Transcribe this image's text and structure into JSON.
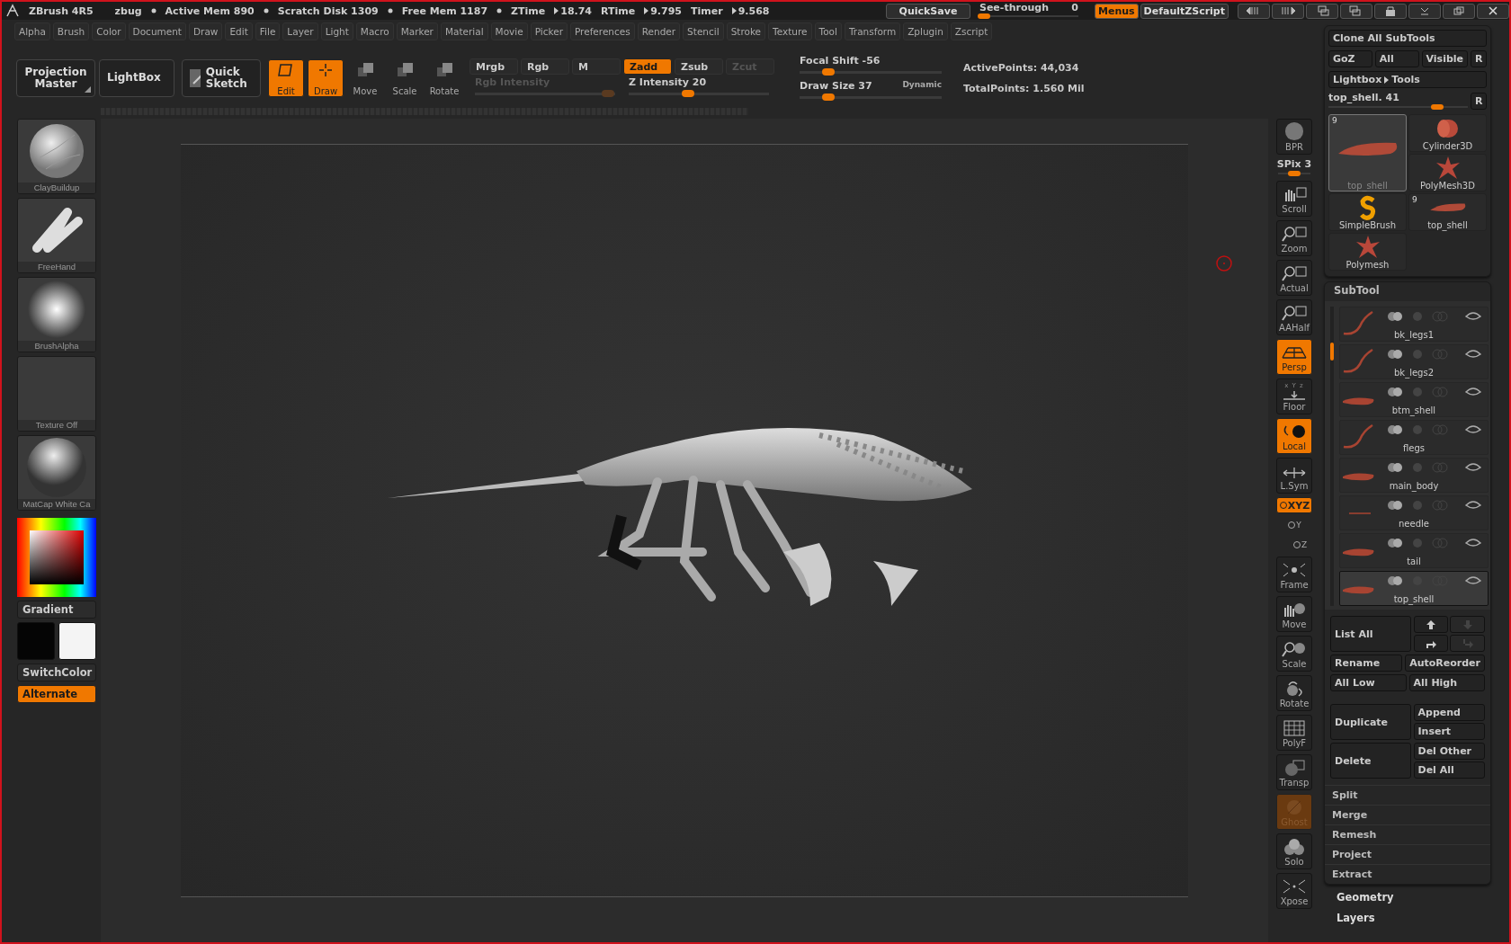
{
  "title_bar": {
    "app": "ZBrush 4R5",
    "document": "zbug",
    "stats": [
      "Active Mem 890",
      "Scratch Disk 1309",
      "Free Mem 1187"
    ],
    "timers": [
      {
        "label": "ZTime",
        "value": "18.74"
      },
      {
        "label": "RTime",
        "value": "9.795"
      },
      {
        "label": "Timer",
        "value": "9.568"
      }
    ],
    "quicksave": "QuickSave",
    "see_through": {
      "label": "See-through",
      "value": "0",
      "level": 0.05
    },
    "menus": {
      "label": "Menus",
      "selected": true
    },
    "script": "DefaultZScript"
  },
  "menu_bar": [
    "Alpha",
    "Brush",
    "Color",
    "Document",
    "Draw",
    "Edit",
    "File",
    "Layer",
    "Light",
    "Macro",
    "Marker",
    "Material",
    "Movie",
    "Picker",
    "Preferences",
    "Render",
    "Stencil",
    "Stroke",
    "Texture",
    "Tool",
    "Transform",
    "Zplugin",
    "Zscript"
  ],
  "shelf": {
    "projection_master": "Projection Master",
    "lightbox": "LightBox",
    "quick_sketch": "Quick Sketch",
    "modes": [
      {
        "kind": "edit",
        "label": "Edit",
        "selected": true
      },
      {
        "kind": "draw",
        "label": "Draw",
        "selected": true
      },
      {
        "kind": "move",
        "label": "Move",
        "selected": false
      },
      {
        "kind": "scale",
        "label": "Scale",
        "selected": false
      },
      {
        "kind": "rotate",
        "label": "Rotate",
        "selected": false
      }
    ],
    "channels": [
      {
        "label": "Mrgb",
        "selected": false,
        "disabled": false
      },
      {
        "label": "Rgb",
        "selected": false,
        "disabled": false
      },
      {
        "label": "M",
        "selected": false,
        "disabled": false
      },
      {
        "label": "Zadd",
        "selected": true,
        "disabled": false
      },
      {
        "label": "Zsub",
        "selected": false,
        "disabled": false
      },
      {
        "label": "Zcut",
        "selected": false,
        "disabled": true
      }
    ],
    "intensity": [
      {
        "label": "Rgb Intensity",
        "level": 0.95,
        "disabled": true
      },
      {
        "label": "Z Intensity 20",
        "level": 0.42,
        "disabled": false
      }
    ],
    "brush_sliders": [
      {
        "label": "Focal Shift -56",
        "level": 0.2
      },
      {
        "label": "Draw Size 37",
        "level": 0.2,
        "tag": "Dynamic"
      }
    ],
    "points": [
      "ActivePoints: 44,034",
      "TotalPoints: 1.560 Mil"
    ]
  },
  "left_panel": {
    "thumbnails": [
      {
        "kind": "sphere",
        "label": "ClayBuildup"
      },
      {
        "kind": "stroke",
        "label": "FreeHand"
      },
      {
        "kind": "alpha",
        "label": "BrushAlpha"
      },
      {
        "kind": "empty",
        "label": "Texture Off"
      },
      {
        "kind": "matcap",
        "label": "MatCap White Ca"
      }
    ],
    "gradient": "Gradient",
    "switch_color": "SwitchColor",
    "alternate": {
      "label": "Alternate",
      "on": true
    }
  },
  "right_shelf": [
    {
      "kind": "bpr",
      "label": "BPR",
      "on": false,
      "disabled": false
    },
    {
      "kind": "slider",
      "label": "SPix 3",
      "level": 0.5
    },
    {
      "kind": "scroll",
      "label": "Scroll",
      "on": false,
      "disabled": false
    },
    {
      "kind": "zoom",
      "label": "Zoom",
      "on": false,
      "disabled": false
    },
    {
      "kind": "actual",
      "label": "Actual",
      "on": false,
      "disabled": false
    },
    {
      "kind": "aahalf",
      "label": "AAHalf",
      "on": false,
      "disabled": false
    },
    {
      "kind": "persp",
      "label": "Persp",
      "on": true,
      "disabled": false
    },
    {
      "kind": "floor",
      "label": "Floor",
      "axes": "x Y z",
      "on": false,
      "disabled": false
    },
    {
      "kind": "local",
      "label": "Local",
      "on": true,
      "disabled": false
    },
    {
      "kind": "lsym",
      "label": "L.Sym",
      "on": false,
      "disabled": false
    },
    {
      "kind": "pill",
      "label": "XYZ",
      "on": true,
      "disabled": false
    },
    {
      "kind": "rot",
      "label": "Y",
      "on": false,
      "disabled": false
    },
    {
      "kind": "rot",
      "label": "Z",
      "on": false,
      "disabled": false
    },
    {
      "kind": "frame",
      "label": "Frame",
      "on": false,
      "disabled": false
    },
    {
      "kind": "move",
      "label": "Move",
      "on": false,
      "disabled": false
    },
    {
      "kind": "scale",
      "label": "Scale",
      "on": false,
      "disabled": false
    },
    {
      "kind": "rotate",
      "label": "Rotate",
      "on": false,
      "disabled": false
    },
    {
      "kind": "polyf",
      "label": "PolyF",
      "on": false,
      "disabled": false
    },
    {
      "kind": "transp",
      "label": "Transp",
      "on": false,
      "disabled": false
    },
    {
      "kind": "ghost",
      "label": "Ghost",
      "on": true,
      "disabled": true
    },
    {
      "kind": "solo",
      "label": "Solo",
      "on": false,
      "disabled": false
    },
    {
      "kind": "xpose",
      "label": "Xpose",
      "on": false,
      "disabled": false
    }
  ],
  "tool_panel": {
    "clone": "Clone All SubTools",
    "goz_row": [
      "GoZ",
      "All",
      "Visible",
      "R"
    ],
    "lightbox": {
      "left": "Lightbox",
      "right": "Tools"
    },
    "current": {
      "label": "top_shell. 41",
      "level": 0.78,
      "reset": "R"
    },
    "tools": [
      {
        "kind": "shell",
        "label": "top_shell",
        "count": "9",
        "selected": true
      },
      {
        "kind": "cylinder",
        "label": "Cylinder3D",
        "selected": false
      },
      {
        "kind": "star",
        "label": "PolyMesh3D",
        "selected": false
      },
      {
        "kind": "brush",
        "label": "SimpleBrush",
        "selected": false
      },
      {
        "kind": "shell",
        "label": "top_shell",
        "count": "9",
        "selected": false
      },
      {
        "kind": "star",
        "label": "Polymesh",
        "selected": false
      }
    ]
  },
  "subtool": {
    "title": "SubTool",
    "items": [
      {
        "kind": "legs",
        "name": "bk_legs1",
        "selected": false,
        "visible": true
      },
      {
        "kind": "legs",
        "name": "bk_legs2",
        "selected": false,
        "visible": true
      },
      {
        "kind": "shell",
        "name": "btm_shell",
        "selected": false,
        "visible": true
      },
      {
        "kind": "legs",
        "name": "flegs",
        "selected": false,
        "visible": true
      },
      {
        "kind": "shell",
        "name": "main_body",
        "selected": false,
        "visible": true
      },
      {
        "kind": "needle",
        "name": "needle",
        "selected": false,
        "visible": true
      },
      {
        "kind": "shell",
        "name": "tail",
        "selected": false,
        "visible": true
      },
      {
        "kind": "shell",
        "name": "top_shell",
        "selected": true,
        "visible": true
      }
    ],
    "list_all": "List All",
    "arrows": [
      {
        "kind": "up",
        "disabled": false
      },
      {
        "kind": "down",
        "disabled": true
      },
      {
        "kind": "turn",
        "disabled": false
      },
      {
        "kind": "turndown",
        "disabled": true
      }
    ],
    "pairs": [
      [
        "Rename",
        "AutoReorder"
      ],
      [
        "All Low",
        "All High"
      ]
    ],
    "groups": [
      {
        "label": "Duplicate",
        "options": [
          "Append",
          "Insert"
        ]
      },
      {
        "label": "Delete",
        "options": [
          "Del Other",
          "Del All"
        ]
      }
    ],
    "actions": [
      "Split",
      "Merge",
      "Remesh",
      "Project",
      "Extract"
    ]
  },
  "sections": [
    "Geometry",
    "Layers"
  ]
}
